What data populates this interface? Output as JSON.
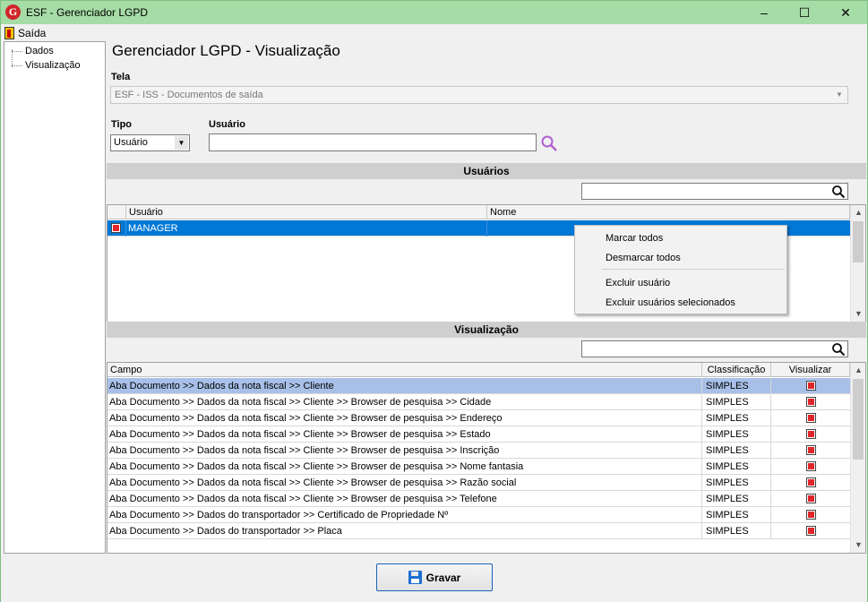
{
  "window": {
    "app_icon_letter": "G",
    "title": "ESF - Gerenciador LGPD",
    "minimize": "–",
    "maximize": "☐",
    "close": "✕"
  },
  "menu": {
    "exit_label": "Saída"
  },
  "tree": {
    "items": [
      {
        "label": "Dados"
      },
      {
        "label": "Visualização"
      }
    ]
  },
  "page": {
    "title": "Gerenciador LGPD - Visualização"
  },
  "tela": {
    "label": "Tela",
    "value": "ESF - ISS - Documentos de saída"
  },
  "tipo": {
    "label": "Tipo",
    "value": "Usuário"
  },
  "usuario": {
    "label": "Usuário",
    "value": ""
  },
  "usuarios_section": {
    "title": "Usuários",
    "search_value": "",
    "columns": [
      "Usuário",
      "Nome"
    ],
    "rows": [
      {
        "checked": true,
        "usuario": "MANAGER",
        "nome": ""
      }
    ]
  },
  "context_menu": {
    "items": [
      "Marcar todos",
      "Desmarcar todos",
      "Excluir usuário",
      "Excluir usuários selecionados"
    ]
  },
  "visualizacao_section": {
    "title": "Visualização",
    "search_value": "",
    "columns": [
      "Campo",
      "Classificação",
      "Visualizar"
    ],
    "rows": [
      {
        "campo": "Aba Documento >> Dados da nota fiscal >> Cliente",
        "classificacao": "SIMPLES",
        "visualizar": true
      },
      {
        "campo": "Aba Documento >> Dados da nota fiscal >> Cliente >> Browser de pesquisa >> Cidade",
        "classificacao": "SIMPLES",
        "visualizar": true
      },
      {
        "campo": "Aba Documento >> Dados da nota fiscal >> Cliente >> Browser de pesquisa >> Endereço",
        "classificacao": "SIMPLES",
        "visualizar": true
      },
      {
        "campo": "Aba Documento >> Dados da nota fiscal >> Cliente >> Browser de pesquisa >> Estado",
        "classificacao": "SIMPLES",
        "visualizar": true
      },
      {
        "campo": "Aba Documento >> Dados da nota fiscal >> Cliente >> Browser de pesquisa >> Inscrição",
        "classificacao": "SIMPLES",
        "visualizar": true
      },
      {
        "campo": "Aba Documento >> Dados da nota fiscal >> Cliente >> Browser de pesquisa >> Nome fantasia",
        "classificacao": "SIMPLES",
        "visualizar": true
      },
      {
        "campo": "Aba Documento >> Dados da nota fiscal >> Cliente >> Browser de pesquisa >> Razão social",
        "classificacao": "SIMPLES",
        "visualizar": true
      },
      {
        "campo": "Aba Documento >> Dados da nota fiscal >> Cliente >> Browser de pesquisa >> Telefone",
        "classificacao": "SIMPLES",
        "visualizar": true
      },
      {
        "campo": "Aba Documento >> Dados do transportador >> Certificado de Propriedade Nº",
        "classificacao": "SIMPLES",
        "visualizar": true
      },
      {
        "campo": "Aba Documento >> Dados do transportador >> Placa",
        "classificacao": "SIMPLES",
        "visualizar": true
      }
    ]
  },
  "footer": {
    "save_label": "Gravar"
  },
  "colors": {
    "selection": "#0078d7",
    "selection_light": "#a8c0e8",
    "title_bar": "#a6dca6",
    "accent_red": "#e0262a"
  },
  "icons": [
    "app-logo-icon",
    "exit-door-icon",
    "search-icon",
    "save-floppy-icon",
    "dropdown-arrow-icon",
    "checkbox-icon"
  ]
}
